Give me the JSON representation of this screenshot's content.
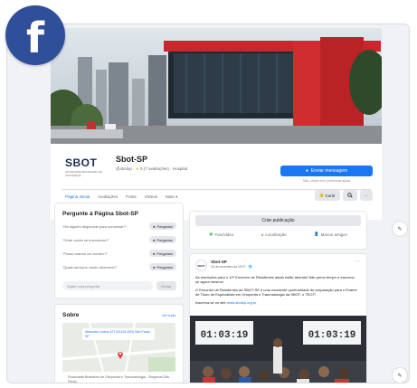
{
  "brand": {
    "logo_letter": "f"
  },
  "page": {
    "logo_word": "SBOT",
    "logo_sub": "SOCIEDADE BRASILEIRA DE ORTOPEDIA",
    "name": "Sbot-SP",
    "meta_handle": "@sbotsp",
    "meta_rating": "5 (7 avaliações)",
    "meta_category": "Hospital",
    "message_button": "Enviar mensagem",
    "message_note": "Não, clique sem problemas ajuda",
    "colors": {
      "accent": "#1877f2",
      "brand_red": "#e53935",
      "fb_badge": "#2f4f9a"
    }
  },
  "tabs": [
    {
      "label": "Página inicial",
      "active": true
    },
    {
      "label": "Avaliações"
    },
    {
      "label": "Fotos"
    },
    {
      "label": "Vídeos"
    },
    {
      "label": "Mais ▾"
    }
  ],
  "tab_actions": {
    "like": "Curtir",
    "search_icon": "search-icon",
    "more": "···"
  },
  "ask": {
    "title": "Pergunte à Página Sbot-SP",
    "questions": [
      "\"Há alguém disponível para conversar?\"",
      "\"Onde vocês se encontram?\"",
      "\"Posso marcar um horário?\"",
      "\"Quais serviços vocês oferecem?\""
    ],
    "ask_button": "Perguntar",
    "input_placeholder": "Digite uma pergunta",
    "send_button": "Enviar"
  },
  "about": {
    "title": "Sobre",
    "see_all": "Ver tudo",
    "address": "Alameda Lorena 427 (01424-000) São Paulo, SP",
    "org": "Sociedade Brasileira de Ortopedia e Traumatologia - Regional São Paulo"
  },
  "create_post": {
    "title": "Criar publicação",
    "actions": [
      "Foto/vídeo",
      "Localização",
      "Marcar amigos"
    ]
  },
  "post": {
    "avatar_text": "SBOT",
    "author": "Sbot-SP",
    "date": "16 de novembro às 15:07 · 🌐",
    "paragraphs": [
      "As inscrições para o 12º Encontro de Residentes ainda estão abertas! Não perca tempo e inscreva-se agora mesmo!",
      "O Encontro de Residentes da SBOT-SP é uma excelente oportunidade de preparação para o Exame de Título de Especialista em Ortopedia e Traumatologia da SBOT, o TEOT!"
    ],
    "cta_prefix": "Inscreva-se no site",
    "cta_link": "www.sbotsp.org.br",
    "timer_left": "01:03:19",
    "timer_right": "01:03:19"
  },
  "side_buttons": [
    "edit-icon",
    "edit-icon"
  ]
}
